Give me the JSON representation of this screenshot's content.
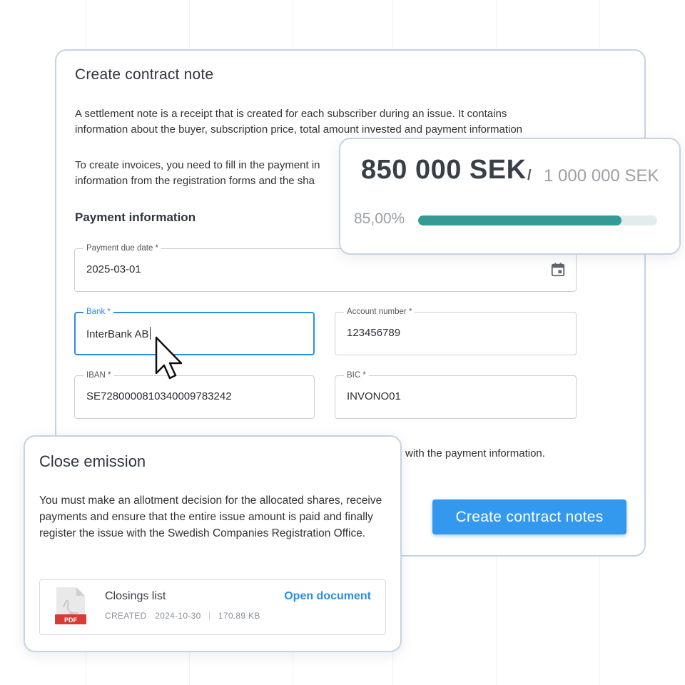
{
  "contract_note": {
    "title": "Create contract note",
    "paragraph1_line1": "A settlement note is a receipt that is created for each subscriber during an issue. It contains",
    "paragraph1_line2": "information about the buyer, subscription price, total amount invested and payment information",
    "paragraph2_line1": "To create invoices, you need to fill in the payment in",
    "paragraph2_line2": "information from the registration forms and the sha",
    "section_title": "Payment information",
    "fields": {
      "due_date": {
        "label": "Payment due date *",
        "value": "2025-03-01",
        "icon": "calendar-icon"
      },
      "bank": {
        "label": "Bank *",
        "value": "InterBank AB",
        "focused": true
      },
      "account_number": {
        "label": "Account number *",
        "value": "123456789"
      },
      "iban": {
        "label": "IBAN *",
        "value": "SE7280000810340009783242"
      },
      "bic": {
        "label": "BIC *",
        "value": "INVONO01"
      }
    },
    "trailing_text": "with the payment information.",
    "primary_button": "Create contract notes"
  },
  "progress": {
    "raised": "850 000 SEK",
    "separator": "/",
    "target": "1 000 000 SEK",
    "percent_label": "85,00%",
    "fraction": 0.85,
    "bar_color": "#339a94"
  },
  "close_emission": {
    "title": "Close emission",
    "description": "You must make an allotment decision for the allocated shares, receive payments and ensure that the entire issue amount is paid and finally register the issue with the Swedish Companies Registration Office.",
    "document": {
      "icon": "pdf-file-icon",
      "icon_label": "PDF",
      "name": "Closings list",
      "created_label": "CREATED",
      "created_date": "2024-10-30",
      "size": "170.89 KB",
      "open_label": "Open document"
    }
  },
  "colors": {
    "accent": "#3399ee",
    "focus": "#2a8ee4",
    "card_border": "#c5d4e2",
    "pdf_red": "#d93a34"
  }
}
